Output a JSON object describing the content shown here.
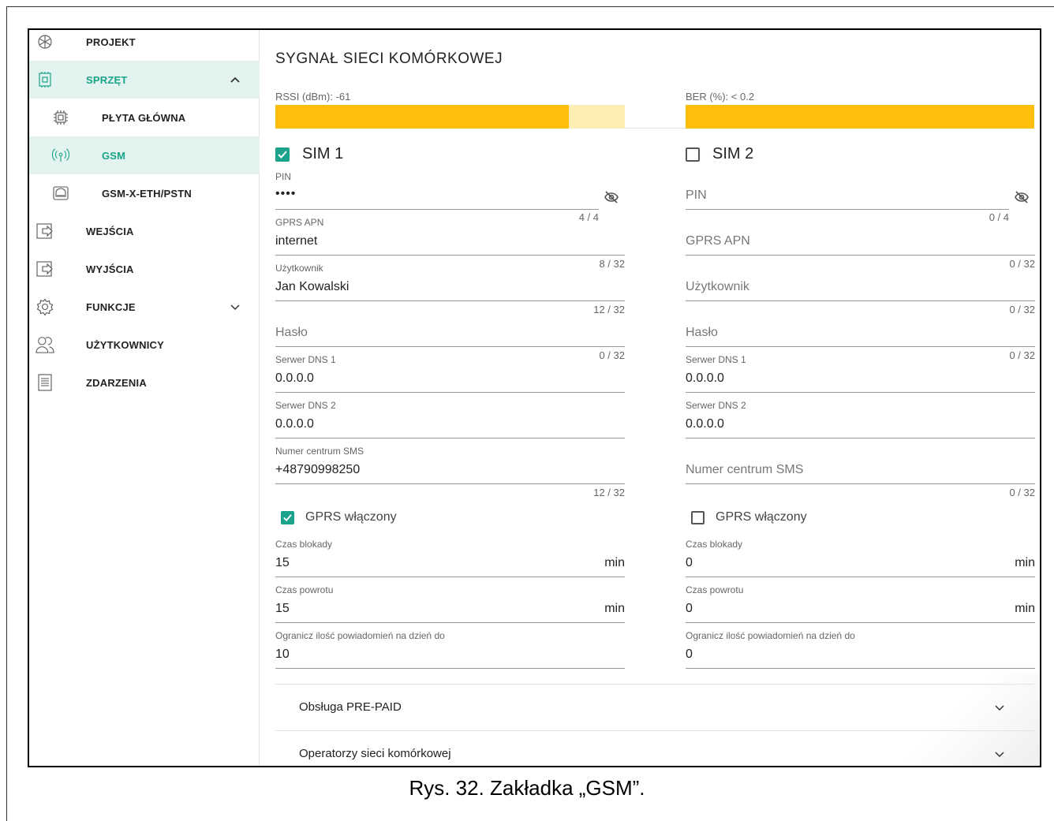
{
  "sidebar": {
    "items": [
      {
        "label": "PROJEKT",
        "icon": "snowflake-icon"
      },
      {
        "label": "SPRZĘT",
        "icon": "chip-icon"
      },
      {
        "label": "PŁYTA GŁÓWNA",
        "icon": "board-icon"
      },
      {
        "label": "GSM",
        "icon": "antenna-icon"
      },
      {
        "label": "GSM-X-ETH/PSTN",
        "icon": "module-icon"
      },
      {
        "label": "WEJŚCIA",
        "icon": "input-icon"
      },
      {
        "label": "WYJŚCIA",
        "icon": "output-icon"
      },
      {
        "label": "FUNKCJE",
        "icon": "gear-icon"
      },
      {
        "label": "UŻYTKOWNICY",
        "icon": "users-icon"
      },
      {
        "label": "ZDARZENIA",
        "icon": "document-icon"
      }
    ]
  },
  "main": {
    "title": "SYGNAŁ SIECI KOMÓRKOWEJ",
    "rssi": {
      "label": "RSSI (dBm): -61",
      "level": 0.84
    },
    "ber": {
      "label": "BER (%): < 0.2",
      "level": 1.0
    },
    "sim1": {
      "title": "SIM 1",
      "checked": true,
      "pin": {
        "label": "PIN",
        "value": "••••",
        "counter": "4 / 4"
      },
      "apn": {
        "label": "GPRS APN",
        "value": "internet",
        "counter": "8 / 32"
      },
      "user": {
        "label": "Użytkownik",
        "value": "Jan Kowalski",
        "counter": "12 / 32"
      },
      "pass": {
        "placeholder": "Hasło",
        "counter": "0 / 32"
      },
      "dns1": {
        "label": "Serwer DNS 1",
        "value": "0.0.0.0"
      },
      "dns2": {
        "label": "Serwer DNS 2",
        "value": "0.0.0.0"
      },
      "sms": {
        "label": "Numer centrum SMS",
        "value": "+48790998250",
        "counter": "12 / 32"
      },
      "gprs": {
        "label": "GPRS włączony",
        "checked": true
      },
      "block": {
        "label": "Czas blokady",
        "value": "15",
        "unit": "min"
      },
      "return": {
        "label": "Czas powrotu",
        "value": "15",
        "unit": "min"
      },
      "limit": {
        "label": "Ogranicz ilość powiadomień na dzień do",
        "value": "10"
      }
    },
    "sim2": {
      "title": "SIM 2",
      "checked": false,
      "pin": {
        "placeholder": "PIN",
        "counter": "0 / 4"
      },
      "apn": {
        "placeholder": "GPRS APN",
        "counter": "0 / 32"
      },
      "user": {
        "placeholder": "Użytkownik",
        "counter": "0 / 32"
      },
      "pass": {
        "placeholder": "Hasło",
        "counter": "0 / 32"
      },
      "dns1": {
        "label": "Serwer DNS 1",
        "value": "0.0.0.0"
      },
      "dns2": {
        "label": "Serwer DNS 2",
        "value": "0.0.0.0"
      },
      "sms": {
        "placeholder": "Numer centrum SMS",
        "counter": "0 / 32"
      },
      "gprs": {
        "label": "GPRS włączony",
        "checked": false
      },
      "block": {
        "label": "Czas blokady",
        "value": "0",
        "unit": "min"
      },
      "return": {
        "label": "Czas powrotu",
        "value": "0",
        "unit": "min"
      },
      "limit": {
        "label": "Ogranicz ilość powiadomień na dzień do",
        "value": "0"
      }
    },
    "accordions": [
      {
        "label": "Obsługa PRE-PAID"
      },
      {
        "label": "Operatorzy sieci komórkowej"
      }
    ]
  },
  "caption": "Rys. 32. Zakładka „GSM”.",
  "colors": {
    "accent": "#1aa38a",
    "active_bg": "#e3f3ef",
    "signal": "#fdbf0b",
    "signal_bg": "#fdecb4"
  }
}
